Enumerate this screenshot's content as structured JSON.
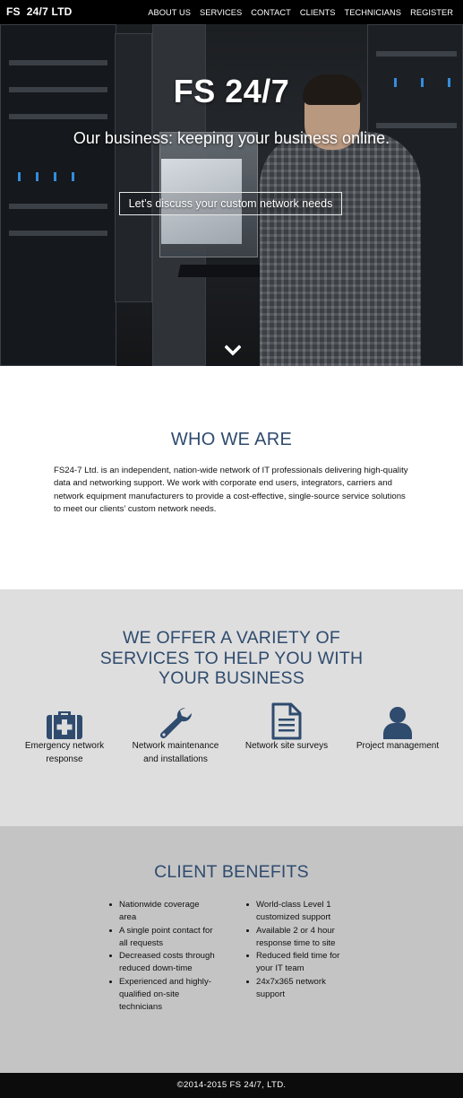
{
  "nav": {
    "brand": "FS  24/7 LTD",
    "items": [
      {
        "label": "ABOUT US"
      },
      {
        "label": "SERVICES"
      },
      {
        "label": "CONTACT"
      },
      {
        "label": "CLIENTS"
      },
      {
        "label": "TECHNICIANS"
      },
      {
        "label": "REGISTER"
      }
    ]
  },
  "hero": {
    "title": "FS 24/7",
    "subtitle": "Our business: keeping your business online.",
    "cta_label": "Let’s discuss your custom network needs",
    "scroll_icon": "chevron-down-icon"
  },
  "who": {
    "heading": "WHO WE ARE",
    "body": "FS24-7 Ltd. is an independent, nation-wide network of IT professionals delivering high-quality data and networking support. We work with corporate end users, integrators, carriers and network equipment manufacturers to provide a cost-effective, single-source service solutions to meet our clients’ custom network needs."
  },
  "services": {
    "heading_lines": [
      "WE OFFER A VARIETY OF",
      "SERVICES TO HELP YOU WITH",
      "YOUR BUSINESS"
    ],
    "items": [
      {
        "icon": "medical-kit-icon",
        "label_lines": [
          "Emergency network",
          "response"
        ]
      },
      {
        "icon": "wrench-icon",
        "label_lines": [
          "Network maintenance",
          "and installations"
        ]
      },
      {
        "icon": "document-icon",
        "label_lines": [
          "Network site surveys"
        ]
      },
      {
        "icon": "user-icon",
        "label_lines": [
          "Project management"
        ]
      }
    ],
    "icon_color": "#2f4b6e"
  },
  "benefits": {
    "heading": "CLIENT BENEFITS",
    "left": [
      {
        "lines": [
          "Nationwide coverage",
          "area"
        ]
      },
      {
        "lines": [
          "A single point contact for",
          "all requests"
        ]
      },
      {
        "lines": [
          "Decreased costs through",
          "reduced down-time"
        ]
      },
      {
        "lines": [
          "Experienced and highly-",
          "qualified on-site",
          "technicians"
        ]
      }
    ],
    "right": [
      {
        "lines": [
          "World-class Level 1",
          "customized support"
        ]
      },
      {
        "lines": [
          "Available 2 or 4 hour",
          "response time to site"
        ]
      },
      {
        "lines": [
          "Reduced field time for",
          "your IT team"
        ]
      },
      {
        "lines": [
          "24x7x365 network",
          "support"
        ]
      }
    ]
  },
  "footer": {
    "copyright": "©2014-2015 FS 24/7, LTD."
  },
  "colors": {
    "accent": "#2f4b6e",
    "nav_bg": "#000000",
    "services_bg": "#dedede",
    "benefits_bg": "#c4c4c4",
    "footer_bg": "#0c0c0c"
  }
}
